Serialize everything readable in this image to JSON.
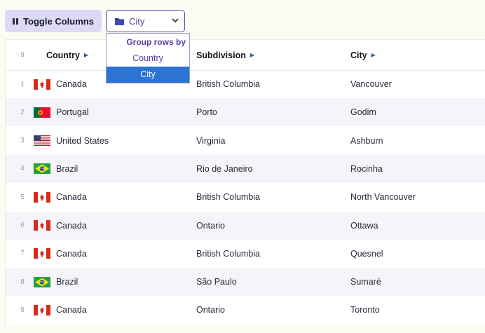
{
  "toolbar": {
    "toggle_label": "Toggle Columns",
    "group_select_value": "City"
  },
  "dropdown": {
    "header": "Group rows by",
    "options": [
      "Country",
      "City"
    ],
    "selected": "City"
  },
  "grid": {
    "row_count_label": "9",
    "columns": [
      "Country",
      "Subdivision",
      "City"
    ],
    "rows": [
      {
        "index": "1",
        "flag": "canada-flag-icon",
        "country": "Canada",
        "subdivision": "British Columbia",
        "city": "Vancouver"
      },
      {
        "index": "2",
        "flag": "portugal-flag-icon",
        "country": "Portugal",
        "subdivision": "Porto",
        "city": "Godim"
      },
      {
        "index": "3",
        "flag": "usa-flag-icon",
        "country": "United States",
        "subdivision": "Virginia",
        "city": "Ashburn"
      },
      {
        "index": "4",
        "flag": "brazil-flag-icon",
        "country": "Brazil",
        "subdivision": "Rio de Janeiro",
        "city": "Rocinha"
      },
      {
        "index": "5",
        "flag": "canada-flag-icon",
        "country": "Canada",
        "subdivision": "British Columbia",
        "city": "North Vancouver"
      },
      {
        "index": "6",
        "flag": "canada-flag-icon",
        "country": "Canada",
        "subdivision": "Ontario",
        "city": "Ottawa"
      },
      {
        "index": "7",
        "flag": "canada-flag-icon",
        "country": "Canada",
        "subdivision": "British Columbia",
        "city": "Quesnel"
      },
      {
        "index": "8",
        "flag": "brazil-flag-icon",
        "country": "Brazil",
        "subdivision": "São Paulo",
        "city": "Sumaré"
      },
      {
        "index": "9",
        "flag": "canada-flag-icon",
        "country": "Canada",
        "subdivision": "Ontario",
        "city": "Toronto"
      }
    ]
  },
  "colors": {
    "accent": "#5a3fa0",
    "selected_option": "#2c73d2",
    "toggle_bg": "#dcdaf6",
    "alt_row": "#f4f4f9"
  }
}
